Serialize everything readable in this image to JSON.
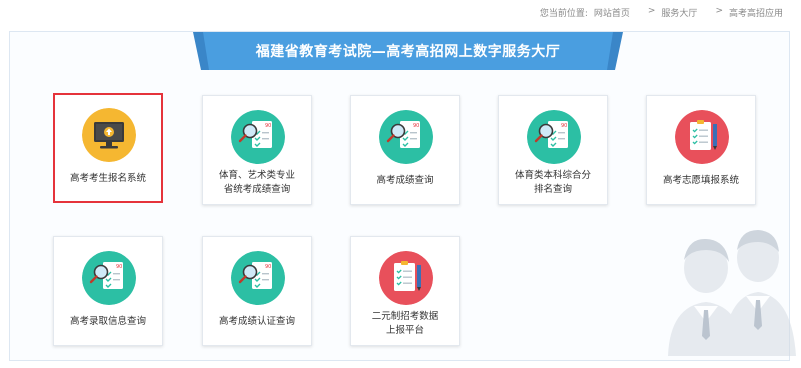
{
  "breadcrumb": {
    "prefix": "您当前位置:",
    "items": [
      "网站首页",
      "服务大厅",
      "高考高招应用"
    ],
    "separator": ">"
  },
  "banner": {
    "title": "福建省教育考试院—高考高招网上数字服务大厅"
  },
  "colors": {
    "accent_blue": "#4a9ee0",
    "selected_border": "#e5333b",
    "teal_icon": "#2cbfa4",
    "red_icon": "#e8505b",
    "yellow_icon": "#f5b731"
  },
  "services": [
    {
      "label": "高考考生报名系统",
      "icon": "monitor-upload-icon",
      "selected": true
    },
    {
      "label": "体育、艺术类专业省统考成绩查询",
      "icon": "search-document-icon",
      "selected": false
    },
    {
      "label": "高考成绩查询",
      "icon": "search-document-icon",
      "selected": false
    },
    {
      "label": "体育类本科综合分排名查询",
      "icon": "search-document-icon",
      "selected": false
    },
    {
      "label": "高考志愿填报系统",
      "icon": "form-pen-icon",
      "selected": false
    },
    {
      "label": "高考录取信息查询",
      "icon": "search-document-icon",
      "selected": false
    },
    {
      "label": "高考成绩认证查询",
      "icon": "search-document-icon",
      "selected": false
    },
    {
      "label": "二元制招考数据上报平台",
      "icon": "form-pen-icon",
      "selected": false
    }
  ],
  "service_label_lines": {
    "1": [
      "体育、艺术类专业",
      "省统考成绩查询"
    ],
    "3": [
      "体育类本科综合分",
      "排名查询"
    ],
    "7": [
      "二元制招考数据",
      "上报平台"
    ]
  }
}
